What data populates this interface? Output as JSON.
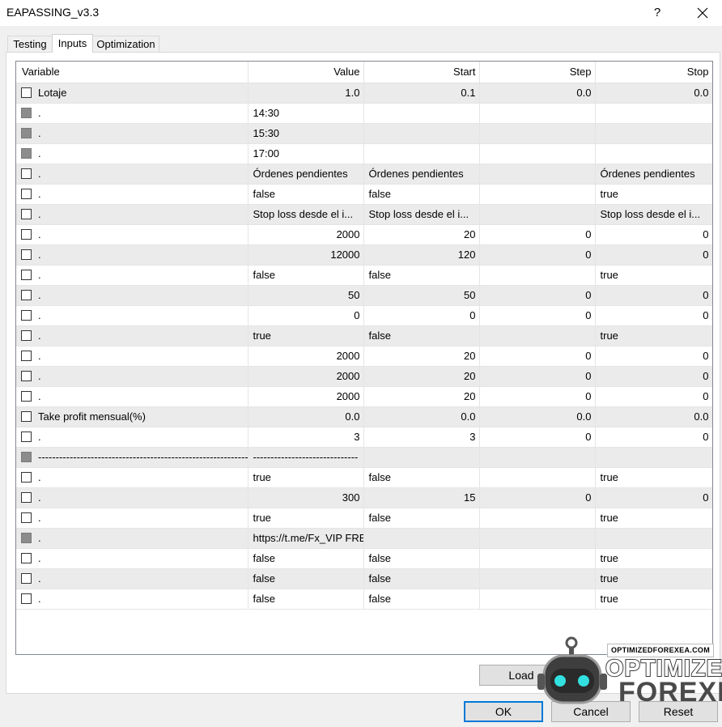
{
  "window": {
    "title": "EAPASSING_v3.3",
    "help_label": "?"
  },
  "tabs": [
    {
      "label": "Testing",
      "active": false
    },
    {
      "label": "Inputs",
      "active": true
    },
    {
      "label": "Optimization",
      "active": false
    }
  ],
  "grid": {
    "columns": [
      "Variable",
      "Value",
      "Start",
      "Step",
      "Stop"
    ],
    "rows": [
      {
        "name": "Lotaje",
        "value": "1.0",
        "start": "0.1",
        "step": "0.0",
        "stop": "0.0",
        "checkbox": "unchecked",
        "numeric": true
      },
      {
        "name": ".",
        "value": "14:30",
        "start": "",
        "step": "",
        "stop": "",
        "checkbox": "disabled",
        "numeric": false
      },
      {
        "name": ".",
        "value": "15:30",
        "start": "",
        "step": "",
        "stop": "",
        "checkbox": "disabled",
        "numeric": false
      },
      {
        "name": ".",
        "value": "17:00",
        "start": "",
        "step": "",
        "stop": "",
        "checkbox": "disabled",
        "numeric": false
      },
      {
        "name": ".",
        "value": "Órdenes pendientes",
        "start": "Órdenes pendientes",
        "step": "",
        "stop": "Órdenes pendientes",
        "checkbox": "unchecked",
        "numeric": false
      },
      {
        "name": ".",
        "value": "false",
        "start": "false",
        "step": "",
        "stop": "true",
        "checkbox": "unchecked",
        "numeric": false
      },
      {
        "name": ".",
        "value": "Stop loss desde el i...",
        "start": "Stop loss desde el i...",
        "step": "",
        "stop": "Stop loss desde el i...",
        "checkbox": "unchecked",
        "numeric": false
      },
      {
        "name": ".",
        "value": "2000",
        "start": "20",
        "step": "0",
        "stop": "0",
        "checkbox": "unchecked",
        "numeric": true
      },
      {
        "name": ".",
        "value": "12000",
        "start": "120",
        "step": "0",
        "stop": "0",
        "checkbox": "unchecked",
        "numeric": true
      },
      {
        "name": ".",
        "value": "false",
        "start": "false",
        "step": "",
        "stop": "true",
        "checkbox": "unchecked",
        "numeric": false
      },
      {
        "name": ".",
        "value": "50",
        "start": "50",
        "step": "0",
        "stop": "0",
        "checkbox": "unchecked",
        "numeric": true
      },
      {
        "name": ".",
        "value": "0",
        "start": "0",
        "step": "0",
        "stop": "0",
        "checkbox": "unchecked",
        "numeric": true
      },
      {
        "name": ".",
        "value": "true",
        "start": "false",
        "step": "",
        "stop": "true",
        "checkbox": "unchecked",
        "numeric": false
      },
      {
        "name": ".",
        "value": "2000",
        "start": "20",
        "step": "0",
        "stop": "0",
        "checkbox": "unchecked",
        "numeric": true
      },
      {
        "name": ".",
        "value": "2000",
        "start": "20",
        "step": "0",
        "stop": "0",
        "checkbox": "unchecked",
        "numeric": true
      },
      {
        "name": ".",
        "value": "2000",
        "start": "20",
        "step": "0",
        "stop": "0",
        "checkbox": "unchecked",
        "numeric": true
      },
      {
        "name": "Take profit mensual(%)",
        "value": "0.0",
        "start": "0.0",
        "step": "0.0",
        "stop": "0.0",
        "checkbox": "unchecked",
        "numeric": true
      },
      {
        "name": ".",
        "value": "3",
        "start": "3",
        "step": "0",
        "stop": "0",
        "checkbox": "unchecked",
        "numeric": true
      },
      {
        "name": "------------------------------------------------------------",
        "value": "------------------------------",
        "start": "",
        "step": "",
        "stop": "",
        "checkbox": "disabled",
        "numeric": false
      },
      {
        "name": ".",
        "value": "true",
        "start": "false",
        "step": "",
        "stop": "true",
        "checkbox": "unchecked",
        "numeric": false
      },
      {
        "name": ".",
        "value": "300",
        "start": "15",
        "step": "0",
        "stop": "0",
        "checkbox": "unchecked",
        "numeric": true
      },
      {
        "name": ".",
        "value": "true",
        "start": "false",
        "step": "",
        "stop": "true",
        "checkbox": "unchecked",
        "numeric": false
      },
      {
        "name": ".",
        "value": "https://t.me/Fx_VIP     FREE EAs",
        "start": "",
        "step": "",
        "stop": "",
        "checkbox": "disabled",
        "numeric": false
      },
      {
        "name": ".",
        "value": "false",
        "start": "false",
        "step": "",
        "stop": "true",
        "checkbox": "unchecked",
        "numeric": false
      },
      {
        "name": ".",
        "value": "false",
        "start": "false",
        "step": "",
        "stop": "true",
        "checkbox": "unchecked",
        "numeric": false
      },
      {
        "name": ".",
        "value": "false",
        "start": "false",
        "step": "",
        "stop": "true",
        "checkbox": "unchecked",
        "numeric": false
      }
    ]
  },
  "buttons": {
    "load": "Load",
    "ok": "OK",
    "cancel": "Cancel",
    "reset": "Reset"
  },
  "watermark": {
    "badge": "OPTIMIZEDFOREXEA.COM",
    "line1": "OPTIMIZED",
    "line2": "FOREXEA"
  },
  "colors": {
    "row_shade": "#ebebeb",
    "disabled_checkbox": "#8c8c8c",
    "ok_border": "#0078d7",
    "button_bg": "#e1e1e1"
  }
}
